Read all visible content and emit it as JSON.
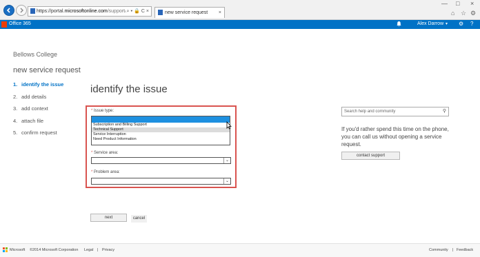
{
  "browser": {
    "address": {
      "domain_prefix": "https://portal.",
      "domain": "microsoftonline.com",
      "path": "/support/New5e"
    },
    "address_icons": "⌕ ▾ 🔒 C ×",
    "tab": {
      "title": "new service request",
      "close": "×"
    },
    "window": {
      "minimize": "—",
      "maximize": "□",
      "close": "×"
    },
    "toolbar_icons": {
      "home": "⌂",
      "favorites": "☆",
      "settings": "⚙"
    }
  },
  "o365": {
    "title": "Office 365",
    "user": "Alex Darrow",
    "caret": "▾",
    "gear": "⚙",
    "help": "?"
  },
  "sidebar": {
    "org": "Bellows College",
    "title": "new service request",
    "steps": [
      {
        "num": "1.",
        "label": "identify the issue",
        "active": true
      },
      {
        "num": "2.",
        "label": "add details"
      },
      {
        "num": "3.",
        "label": "add context"
      },
      {
        "num": "4.",
        "label": "attach file"
      },
      {
        "num": "5.",
        "label": "confirm request"
      }
    ]
  },
  "main": {
    "heading": "identify the issue",
    "issue_type": {
      "required": "*",
      "label": "Issue type:",
      "options": [
        "Subscription and Billing Support",
        "Technical Support",
        "Service Interruption",
        "Need Product Information"
      ],
      "hovered_option": "Technical Support"
    },
    "service_area": {
      "required": "*",
      "label": "Service area:",
      "value": ""
    },
    "problem_area": {
      "required": "*",
      "label": "Problem area:",
      "value": ""
    },
    "next_label": "next",
    "cancel_label": "cancel"
  },
  "help": {
    "search_placeholder": "Search help and community",
    "text": "If you'd rather spend this time on the phone, you can call us without opening a service request.",
    "contact_label": "contact support"
  },
  "footer": {
    "brand": "Microsoft",
    "copyright": "©2014 Microsoft Corporation",
    "legal": "Legal",
    "separator": "|",
    "privacy": "Privacy",
    "community": "Community",
    "feedback": "Feedback"
  },
  "colors": {
    "accent": "#0072c6",
    "highlight_border": "#d9534f",
    "selected_option": "#1e90e0"
  }
}
